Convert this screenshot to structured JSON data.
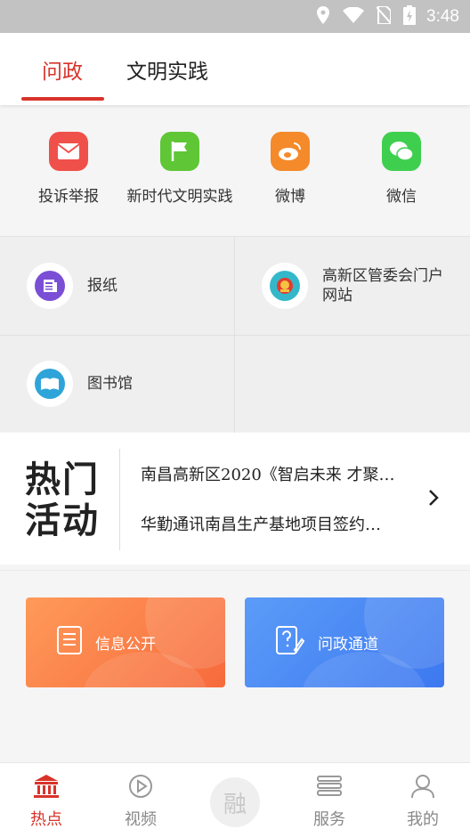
{
  "status_bar": {
    "time": "3:48"
  },
  "tabs": [
    {
      "label": "问政",
      "active": true
    },
    {
      "label": "文明实践",
      "active": false
    }
  ],
  "quick_links": [
    {
      "label": "投诉举报",
      "icon": "envelope-icon",
      "color": "#f0504a"
    },
    {
      "label": "新时代文明实践",
      "icon": "flag-icon",
      "color": "#5fc636"
    },
    {
      "label": "微博",
      "icon": "weibo-icon",
      "color": "#f58a2a"
    },
    {
      "label": "微信",
      "icon": "wechat-icon",
      "color": "#3fcf4f"
    }
  ],
  "grid_links": [
    {
      "label": "报纸",
      "icon": "newspaper-icon",
      "color": "#7a4fd6"
    },
    {
      "label": "高新区管委会门户网站",
      "icon": "national-emblem-icon",
      "color": "#34b8c9"
    },
    {
      "label": "图书馆",
      "icon": "book-icon",
      "color": "#2fa4d9"
    }
  ],
  "hot_activities": {
    "title_line1": "热门",
    "title_line2": "活动",
    "items": [
      "南昌高新区2020《智启未来 才聚…",
      "华勤通讯南昌生产基地项目签约…"
    ]
  },
  "cards": [
    {
      "label": "信息公开",
      "icon": "document-list-icon",
      "color_start": "#ff9a5a",
      "color_end": "#f76a3c"
    },
    {
      "label": "问政通道",
      "icon": "question-edit-icon",
      "color_start": "#5b9cf8",
      "color_end": "#3d78f0"
    }
  ],
  "bottom_nav": [
    {
      "label": "热点",
      "icon": "bank-building-icon",
      "active": true
    },
    {
      "label": "视频",
      "icon": "play-circle-icon",
      "active": false
    },
    {
      "label": "融",
      "icon": "center-fusion-button",
      "active": false
    },
    {
      "label": "服务",
      "icon": "list-icon",
      "active": false
    },
    {
      "label": "我的",
      "icon": "user-icon",
      "active": false
    }
  ],
  "colors": {
    "accent": "#d8332a"
  }
}
